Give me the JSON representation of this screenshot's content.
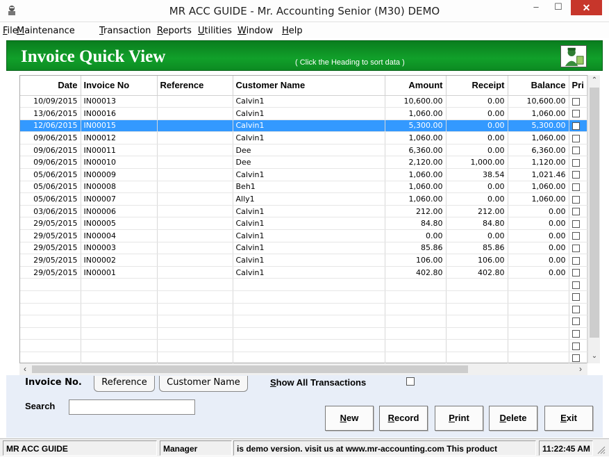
{
  "window": {
    "title": "MR ACC GUIDE - Mr. Accounting Senior (M30) DEMO",
    "min_glyph": "–",
    "max_glyph": "☐",
    "close_glyph": "✕"
  },
  "menu": [
    {
      "first": "F",
      "rest": "ile"
    },
    {
      "first": "M",
      "rest": "aintenance"
    },
    {
      "first": "T",
      "rest": "ransaction"
    },
    {
      "first": "R",
      "rest": "eports"
    },
    {
      "first": "U",
      "rest": "tilities"
    },
    {
      "first": "W",
      "rest": "indow"
    },
    {
      "first": "H",
      "rest": "elp"
    }
  ],
  "header": {
    "title": "Invoice Quick View",
    "hint": "( Click the Heading to sort data )",
    "accent": "#11a02a"
  },
  "grid": {
    "columns": [
      "Date",
      "Invoice No",
      "Reference",
      "Customer Name",
      "Amount",
      "Receipt",
      "Balance",
      "Pri"
    ],
    "rows": [
      {
        "date": "10/09/2015",
        "invoice": "IN00013",
        "reference": "",
        "customer": "Calvin1",
        "amount": "10,600.00",
        "receipt": "0.00",
        "balance": "10,600.00"
      },
      {
        "date": "13/06/2015",
        "invoice": "IN00016",
        "reference": "",
        "customer": "Calvin1",
        "amount": "1,060.00",
        "receipt": "0.00",
        "balance": "1,060.00"
      },
      {
        "date": "12/06/2015",
        "invoice": "IN00015",
        "reference": "",
        "customer": "Calvin1",
        "amount": "5,300.00",
        "receipt": "0.00",
        "balance": "5,300.00",
        "selected": true
      },
      {
        "date": "09/06/2015",
        "invoice": "IN00012",
        "reference": "",
        "customer": "Calvin1",
        "amount": "1,060.00",
        "receipt": "0.00",
        "balance": "1,060.00"
      },
      {
        "date": "09/06/2015",
        "invoice": "IN00011",
        "reference": "",
        "customer": "Dee",
        "amount": "6,360.00",
        "receipt": "0.00",
        "balance": "6,360.00"
      },
      {
        "date": "09/06/2015",
        "invoice": "IN00010",
        "reference": "",
        "customer": "Dee",
        "amount": "2,120.00",
        "receipt": "1,000.00",
        "balance": "1,120.00"
      },
      {
        "date": "05/06/2015",
        "invoice": "IN00009",
        "reference": "",
        "customer": "Calvin1",
        "amount": "1,060.00",
        "receipt": "38.54",
        "balance": "1,021.46"
      },
      {
        "date": "05/06/2015",
        "invoice": "IN00008",
        "reference": "",
        "customer": "Beh1",
        "amount": "1,060.00",
        "receipt": "0.00",
        "balance": "1,060.00"
      },
      {
        "date": "05/06/2015",
        "invoice": "IN00007",
        "reference": "",
        "customer": "Ally1",
        "amount": "1,060.00",
        "receipt": "0.00",
        "balance": "1,060.00"
      },
      {
        "date": "03/06/2015",
        "invoice": "IN00006",
        "reference": "",
        "customer": "Calvin1",
        "amount": "212.00",
        "receipt": "212.00",
        "balance": "0.00"
      },
      {
        "date": "29/05/2015",
        "invoice": "IN00005",
        "reference": "",
        "customer": "Calvin1",
        "amount": "84.80",
        "receipt": "84.80",
        "balance": "0.00"
      },
      {
        "date": "29/05/2015",
        "invoice": "IN00004",
        "reference": "",
        "customer": "Calvin1",
        "amount": "0.00",
        "receipt": "0.00",
        "balance": "0.00"
      },
      {
        "date": "29/05/2015",
        "invoice": "IN00003",
        "reference": "",
        "customer": "Calvin1",
        "amount": "85.86",
        "receipt": "85.86",
        "balance": "0.00"
      },
      {
        "date": "29/05/2015",
        "invoice": "IN00002",
        "reference": "",
        "customer": "Calvin1",
        "amount": "106.00",
        "receipt": "106.00",
        "balance": "0.00"
      },
      {
        "date": "29/05/2015",
        "invoice": "IN00001",
        "reference": "",
        "customer": "Calvin1",
        "amount": "402.80",
        "receipt": "402.80",
        "balance": "0.00"
      }
    ],
    "empty_rows": 7,
    "selection_color": "#3399ff",
    "scroll_up": "⌃",
    "scroll_down": "⌄",
    "scroll_left": "‹",
    "scroll_right": "›"
  },
  "tabs": [
    "Invoice No.",
    "Reference",
    "Customer Name"
  ],
  "show_all": {
    "first": "S",
    "rest": "how All Transactions"
  },
  "search": {
    "label": "Search",
    "value": ""
  },
  "buttons": [
    {
      "first": "N",
      "rest": "ew"
    },
    {
      "first": "R",
      "rest": "ecord"
    },
    {
      "first": "P",
      "rest": "rint"
    },
    {
      "first": "D",
      "rest": "elete"
    },
    {
      "first": "E",
      "rest": "xit"
    }
  ],
  "status": {
    "company": "MR ACC GUIDE",
    "user": "Manager",
    "message": "is demo version.  visit us at www.mr-accounting.com This product",
    "time": "11:22:45 AM"
  }
}
